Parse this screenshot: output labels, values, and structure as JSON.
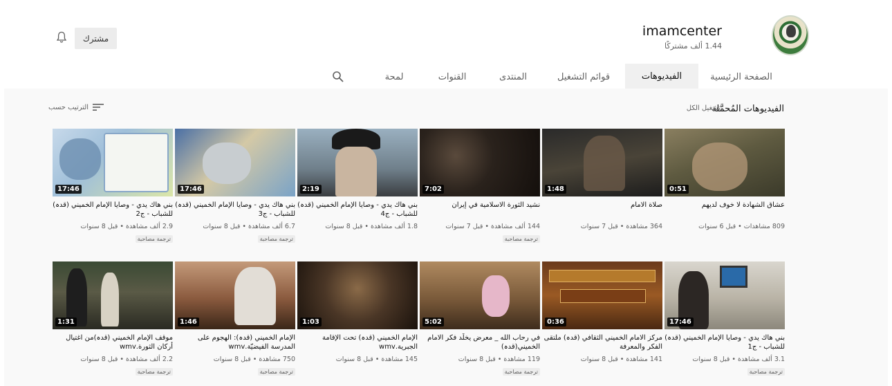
{
  "channel": {
    "name": "imamcenter",
    "subscribers": "1.44 ألف مشتركًا"
  },
  "header": {
    "subscribe_label": "مشترك"
  },
  "tabs": [
    {
      "label": "الصفحة الرئيسية",
      "active": false
    },
    {
      "label": "الفيديوهات",
      "active": true
    },
    {
      "label": "قوائم التشغيل",
      "active": false
    },
    {
      "label": "المنتدى",
      "active": false
    },
    {
      "label": "القنوات",
      "active": false
    },
    {
      "label": "لمحة",
      "active": false
    }
  ],
  "shelf": {
    "title": "الفيديوهات المُحمَّلة",
    "play_all": "تشغيل الكل",
    "sort_by": "الترتيب حسب"
  },
  "videos": [
    {
      "title": "عشاق الشهادة لا خوف لديهم",
      "meta": "809 مشاهدات • قبل 6 سنوات",
      "duration": "0:51",
      "badge": ""
    },
    {
      "title": "صلاة الامام",
      "meta": "364 مشاهدة • قبل 7 سنوات",
      "duration": "1:48",
      "badge": ""
    },
    {
      "title": "نشيد الثورة الاسلامية في إيران",
      "meta": "144 ألف مشاهدة • قبل 7 سنوات",
      "duration": "7:02",
      "badge": "ترجمة مصاحبة"
    },
    {
      "title": "بني هاك يدي - وصايا الإمام الخميني (قدہ) للشباب - ج4",
      "meta": "1.8 ألف مشاهدة • قبل 8 سنوات",
      "duration": "2:19",
      "badge": ""
    },
    {
      "title": "بني هاك يدي - وصايا الإمام الخميني (قدہ) للشباب - ج3",
      "meta": "6.7 ألف مشاهدة • قبل 8 سنوات",
      "duration": "17:46",
      "badge": "ترجمة مصاحبة"
    },
    {
      "title": "بني هاك يدي - وصايا الإمام الخميني (قدہ) للشباب - ج2",
      "meta": "2.9 ألف مشاهدة • قبل 8 سنوات",
      "duration": "17:46",
      "badge": "ترجمة مصاحبة"
    },
    {
      "title": "بني هاك يدي - وصايا الإمام الخميني (قدہ) للشباب - ج1",
      "meta": "3.1 ألف مشاهدة • قبل 8 سنوات",
      "duration": "17:46",
      "badge": "ترجمة مصاحبة"
    },
    {
      "title": "مركز الامام الخميني الثقافي (قدہ) ملتقى الفكر والمعرفة",
      "meta": "141 مشاهدة • قبل 8 سنوات",
      "duration": "0:36",
      "badge": ""
    },
    {
      "title": "في رحاب الله _ معرض يخلّد فكر الامام الخميني(قدہ)",
      "meta": "119 مشاهدة • قبل 8 سنوات",
      "duration": "5:02",
      "badge": "ترجمة مصاحبة"
    },
    {
      "title": "الإمام الخميني (قدہ) تحت الإقامة الجبرية.wmv",
      "meta": "145 مشاهدة • قبل 8 سنوات",
      "duration": "1:03",
      "badge": ""
    },
    {
      "title": "الإمام الخميني (قدہ): الهجوم على المدرسة الفيضيّة.wmv",
      "meta": "750 مشاهدة • قبل 8 سنوات",
      "duration": "1:46",
      "badge": "ترجمة مصاحبة"
    },
    {
      "title": "موقف الإمام الخميني (قدہ)من اغتيال أركان الثورة.wmv",
      "meta": "2.2 ألف مشاهدة • قبل 8 سنوات",
      "duration": "1:31",
      "badge": "ترجمة مصاحبة"
    }
  ]
}
